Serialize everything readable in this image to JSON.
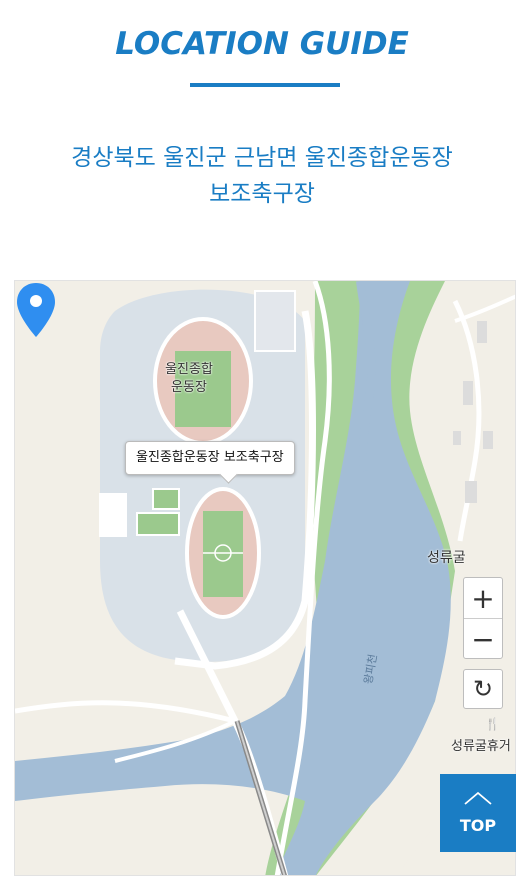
{
  "title": "LOCATION GUIDE",
  "address": {
    "line1": "경상북도 울진군 근남면 울진종합운동장",
    "line2": "보조축구장"
  },
  "map": {
    "marker_label": "울진종합운동장 보조축구장",
    "labels": {
      "stadium": [
        "울진종합",
        "운동장"
      ],
      "village": "성류굴",
      "rest_area": "성류굴휴거",
      "river": "왕피천"
    },
    "controls": {
      "zoom_in": "+",
      "zoom_out": "−",
      "reset": "↻"
    },
    "colors": {
      "land": "#f2efe7",
      "water": "#a3bdd6",
      "green": "#a8d29a",
      "complex": "#d9e1e8",
      "marker": "#2f8ef0"
    }
  },
  "top_button": {
    "label": "TOP"
  },
  "colors": {
    "accent": "#1a7dc4"
  }
}
